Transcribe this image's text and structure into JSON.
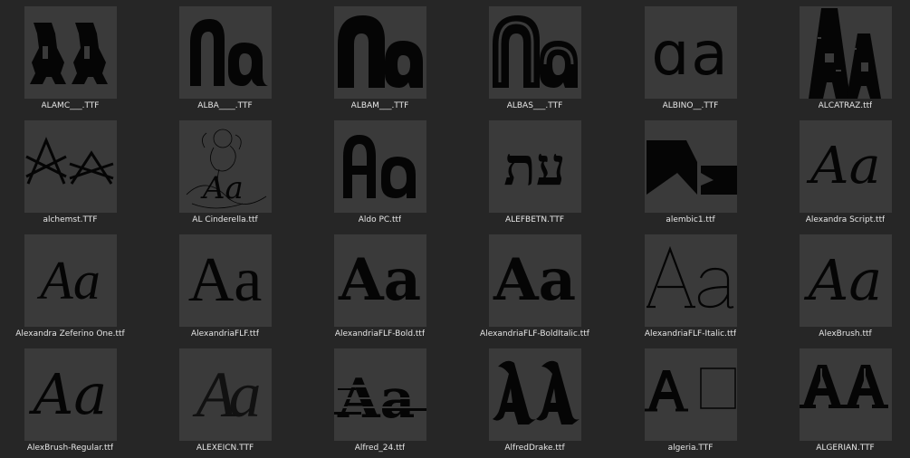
{
  "files": [
    {
      "name": "ALAMC___.TTF",
      "icon": "font-preview-icon"
    },
    {
      "name": "ALBA____.TTF",
      "icon": "font-preview-icon"
    },
    {
      "name": "ALBAM___.TTF",
      "icon": "font-preview-icon"
    },
    {
      "name": "ALBAS___.TTF",
      "icon": "font-preview-icon"
    },
    {
      "name": "ALBINO__.TTF",
      "icon": "font-preview-icon"
    },
    {
      "name": "ALCATRAZ.ttf",
      "icon": "font-preview-icon"
    },
    {
      "name": "alchemst.TTF",
      "icon": "font-preview-icon"
    },
    {
      "name": "AL Cinderella.ttf",
      "icon": "font-preview-icon"
    },
    {
      "name": "Aldo PC.ttf",
      "icon": "font-preview-icon"
    },
    {
      "name": "ALEFBETN.TTF",
      "icon": "font-preview-icon"
    },
    {
      "name": "alembic1.ttf",
      "icon": "font-preview-icon"
    },
    {
      "name": "Alexandra Script.ttf",
      "icon": "font-preview-icon"
    },
    {
      "name": "Alexandra Zeferino One.ttf",
      "icon": "font-preview-icon"
    },
    {
      "name": "AlexandriaFLF.ttf",
      "icon": "font-preview-icon"
    },
    {
      "name": "AlexandriaFLF-Bold.ttf",
      "icon": "font-preview-icon"
    },
    {
      "name": "AlexandriaFLF-BoldItalic.ttf",
      "icon": "font-preview-icon"
    },
    {
      "name": "AlexandriaFLF-Italic.ttf",
      "icon": "font-preview-icon"
    },
    {
      "name": "AlexBrush.ttf",
      "icon": "font-preview-icon"
    },
    {
      "name": "AlexBrush-Regular.ttf",
      "icon": "font-preview-icon"
    },
    {
      "name": "ALEXEICN.TTF",
      "icon": "font-preview-icon"
    },
    {
      "name": "Alfred_24.ttf",
      "icon": "font-preview-icon"
    },
    {
      "name": "AlfredDrake.ttf",
      "icon": "font-preview-icon"
    },
    {
      "name": "algeria.TTF",
      "icon": "font-preview-icon"
    },
    {
      "name": "ALGERIAN.TTF",
      "icon": "font-preview-icon"
    }
  ],
  "previews": {
    "sample": "Aa",
    "hebrew": "עת",
    "alt_sample": "AA",
    "greek": "Aa"
  },
  "colors": {
    "background": "#262626",
    "thumbnail": "#3a3a3a",
    "glyph": "#050505",
    "label": "#e6e6e6"
  }
}
